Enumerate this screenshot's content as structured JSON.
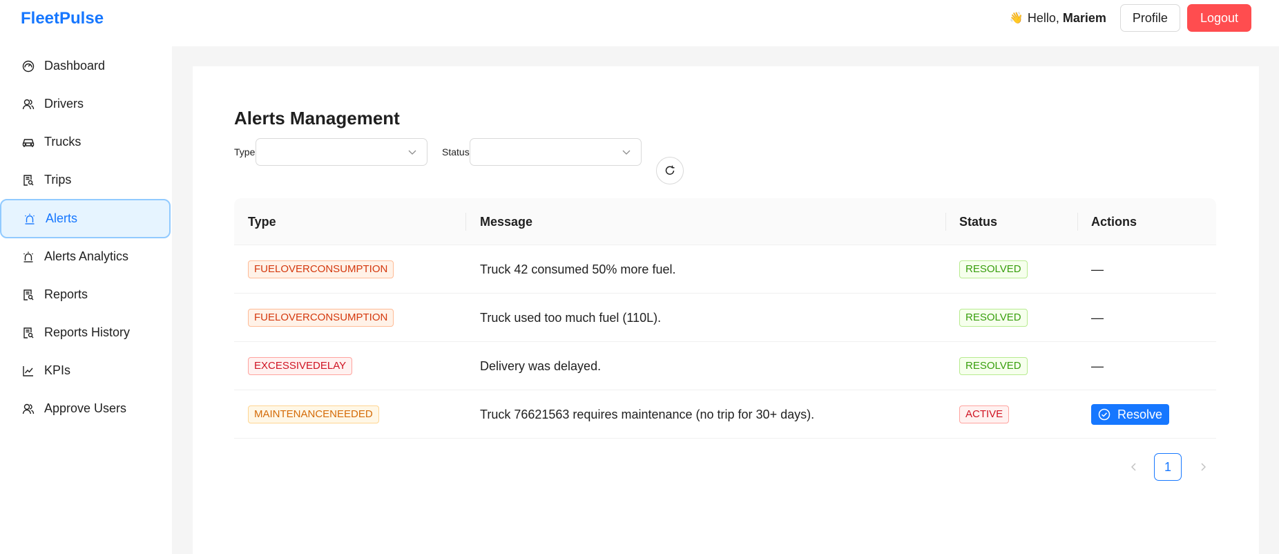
{
  "app": {
    "name": "FleetPulse"
  },
  "header": {
    "greeting_prefix": "Hello,",
    "user_name": "Mariem",
    "wave_icon": "👋",
    "profile_label": "Profile",
    "logout_label": "Logout"
  },
  "sidebar": {
    "items": [
      {
        "label": "Dashboard",
        "icon": "dashboard-icon"
      },
      {
        "label": "Drivers",
        "icon": "users-icon"
      },
      {
        "label": "Trucks",
        "icon": "car-icon"
      },
      {
        "label": "Trips",
        "icon": "file-search-icon"
      },
      {
        "label": "Alerts",
        "icon": "alert-icon",
        "active": true
      },
      {
        "label": "Alerts Analytics",
        "icon": "alert-icon"
      },
      {
        "label": "Reports",
        "icon": "file-search-icon"
      },
      {
        "label": "Reports History",
        "icon": "file-search-icon"
      },
      {
        "label": "KPIs",
        "icon": "line-chart-icon"
      },
      {
        "label": "Approve Users",
        "icon": "users-icon"
      }
    ]
  },
  "main": {
    "title": "Alerts Management",
    "filters": {
      "type_label": "Type",
      "status_label": "Status"
    },
    "table": {
      "columns": [
        "Type",
        "Message",
        "Status",
        "Actions"
      ],
      "rows": [
        {
          "type": "FUELOVERCONSUMPTION",
          "message": "Truck 42 consumed 50% more fuel.",
          "status": "RESOLVED",
          "action": "—"
        },
        {
          "type": "FUELOVERCONSUMPTION",
          "message": "Truck used too much fuel (110L).",
          "status": "RESOLVED",
          "action": "—"
        },
        {
          "type": "EXCESSIVEDELAY",
          "message": "Delivery was delayed.",
          "status": "RESOLVED",
          "action": "—"
        },
        {
          "type": "MAINTENANCENEEDED",
          "message": "Truck 76621563 requires maintenance (no trip for 30+ days).",
          "status": "ACTIVE",
          "action": "Resolve"
        }
      ]
    },
    "pagination": {
      "current_page": "1"
    }
  },
  "colors": {
    "primary": "#1677ff",
    "danger": "#ff4d4f",
    "background": "#f5f5f5"
  }
}
